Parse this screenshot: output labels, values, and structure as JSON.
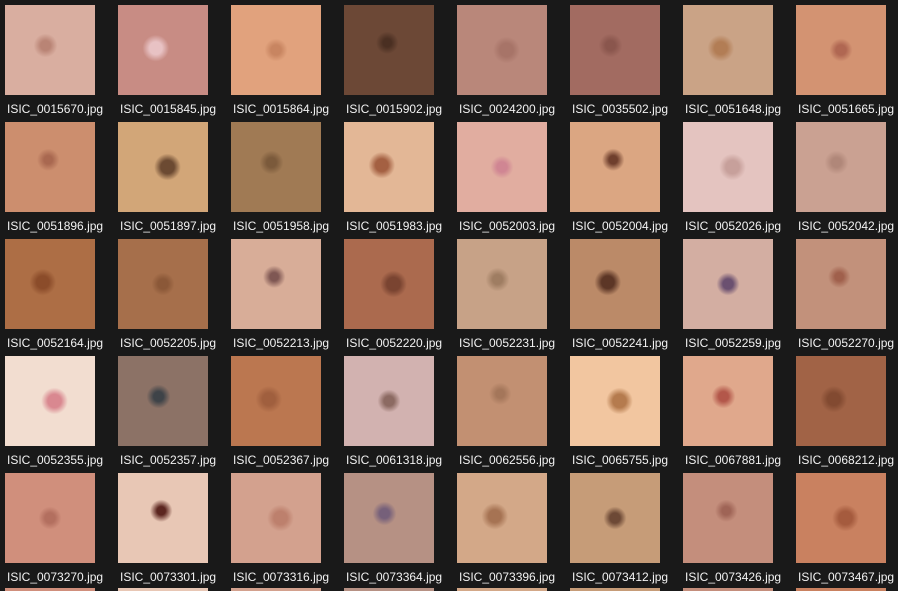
{
  "files": [
    {
      "name": "ISIC_0015670.jpg",
      "bg": "#d9aea0",
      "spot": "#b98475"
    },
    {
      "name": "ISIC_0015845.jpg",
      "bg": "#c88c84",
      "spot": "#e8c2c4"
    },
    {
      "name": "ISIC_0015864.jpg",
      "bg": "#e1a27d",
      "spot": "#c88561"
    },
    {
      "name": "ISIC_0015902.jpg",
      "bg": "#6c4836",
      "spot": "#4a2f22"
    },
    {
      "name": "ISIC_0024200.jpg",
      "bg": "#b9877a",
      "spot": "#a77468"
    },
    {
      "name": "ISIC_0035502.jpg",
      "bg": "#a26b61",
      "spot": "#8a564d"
    },
    {
      "name": "ISIC_0051648.jpg",
      "bg": "#caa386",
      "spot": "#b27d55"
    },
    {
      "name": "ISIC_0051665.jpg",
      "bg": "#d39372",
      "spot": "#b06752"
    },
    {
      "name": "ISIC_0051896.jpg",
      "bg": "#cc8e6e",
      "spot": "#a96850"
    },
    {
      "name": "ISIC_0051897.jpg",
      "bg": "#d2a678",
      "spot": "#6c4a32"
    },
    {
      "name": "ISIC_0051958.jpg",
      "bg": "#a07a54",
      "spot": "#7b5a3b"
    },
    {
      "name": "ISIC_0051983.jpg",
      "bg": "#e3b796",
      "spot": "#a46042"
    },
    {
      "name": "ISIC_0052003.jpg",
      "bg": "#e1ada0",
      "spot": "#d08693"
    },
    {
      "name": "ISIC_0052004.jpg",
      "bg": "#dba682",
      "spot": "#6f3f2d"
    },
    {
      "name": "ISIC_0052026.jpg",
      "bg": "#e4c4c0",
      "spot": "#c7a09b"
    },
    {
      "name": "ISIC_0052042.jpg",
      "bg": "#caa192",
      "spot": "#b08779"
    },
    {
      "name": "ISIC_0052164.jpg",
      "bg": "#ad6e45",
      "spot": "#8b4c2a"
    },
    {
      "name": "ISIC_0052205.jpg",
      "bg": "#a66f4b",
      "spot": "#8b5838"
    },
    {
      "name": "ISIC_0052213.jpg",
      "bg": "#d8ad98",
      "spot": "#7f5753"
    },
    {
      "name": "ISIC_0052220.jpg",
      "bg": "#ab6a4e",
      "spot": "#7a4431"
    },
    {
      "name": "ISIC_0052231.jpg",
      "bg": "#c7a287",
      "spot": "#9f7d62"
    },
    {
      "name": "ISIC_0052241.jpg",
      "bg": "#bb8a68",
      "spot": "#5c3626"
    },
    {
      "name": "ISIC_0052259.jpg",
      "bg": "#d3aea2",
      "spot": "#6b5070"
    },
    {
      "name": "ISIC_0052270.jpg",
      "bg": "#c2917b",
      "spot": "#a0604c"
    },
    {
      "name": "ISIC_0052355.jpg",
      "bg": "#f2ddd0",
      "spot": "#d98890"
    },
    {
      "name": "ISIC_0052357.jpg",
      "bg": "#8c7266",
      "spot": "#3e4348"
    },
    {
      "name": "ISIC_0052367.jpg",
      "bg": "#bb7750",
      "spot": "#a05f3e"
    },
    {
      "name": "ISIC_0061318.jpg",
      "bg": "#d2b2b0",
      "spot": "#8c6a62"
    },
    {
      "name": "ISIC_0062556.jpg",
      "bg": "#c29072",
      "spot": "#a4765a"
    },
    {
      "name": "ISIC_0065755.jpg",
      "bg": "#f2c6a0",
      "spot": "#b57b4e"
    },
    {
      "name": "ISIC_0067881.jpg",
      "bg": "#e0a88c",
      "spot": "#b3574a"
    },
    {
      "name": "ISIC_0068212.jpg",
      "bg": "#a16346",
      "spot": "#824a31"
    },
    {
      "name": "ISIC_0073270.jpg",
      "bg": "#d08f7c",
      "spot": "#b36f5f"
    },
    {
      "name": "ISIC_0073301.jpg",
      "bg": "#e8c7b5",
      "spot": "#5c2620"
    },
    {
      "name": "ISIC_0073316.jpg",
      "bg": "#d3a18e",
      "spot": "#bd806d"
    },
    {
      "name": "ISIC_0073364.jpg",
      "bg": "#b69184",
      "spot": "#76607a"
    },
    {
      "name": "ISIC_0073396.jpg",
      "bg": "#d3a888",
      "spot": "#a67353"
    },
    {
      "name": "ISIC_0073412.jpg",
      "bg": "#c69c78",
      "spot": "#6d4936"
    },
    {
      "name": "ISIC_0073426.jpg",
      "bg": "#c48e7c",
      "spot": "#9f6456"
    },
    {
      "name": "ISIC_0073467.jpg",
      "bg": "#c98160",
      "spot": "#a55b3e"
    }
  ]
}
